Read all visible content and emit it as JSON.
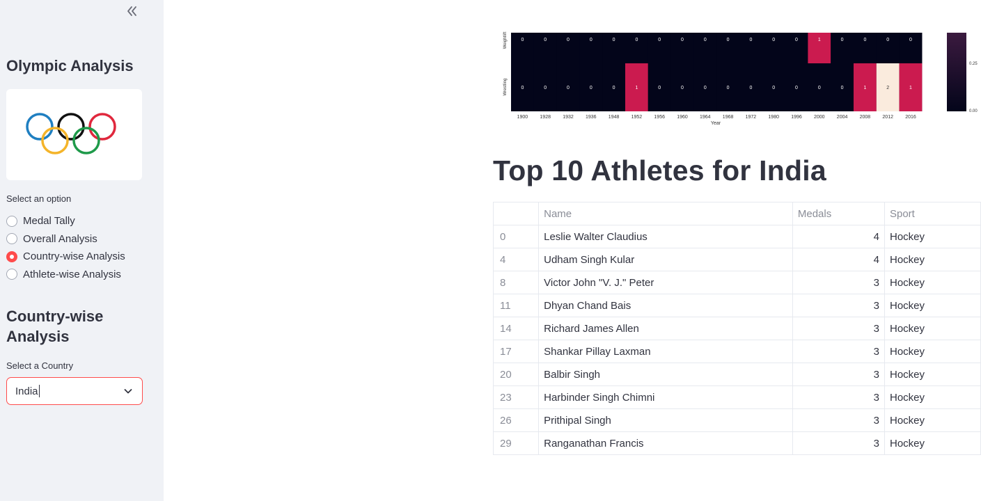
{
  "sidebar": {
    "collapse_icon": "double-chevron-left-icon",
    "title": "Olympic Analysis",
    "logo": "olympic-rings-logo",
    "option_label": "Select an option",
    "options": [
      {
        "label": "Medal Tally",
        "selected": false
      },
      {
        "label": "Overall Analysis",
        "selected": false
      },
      {
        "label": "Country-wise Analysis",
        "selected": true
      },
      {
        "label": "Athlete-wise Analysis",
        "selected": false
      }
    ],
    "subtitle": "Country-wise Analysis",
    "country_label": "Select a Country",
    "country_value": "India"
  },
  "chart_data": {
    "type": "heatmap",
    "x": [
      "1900",
      "1928",
      "1932",
      "1936",
      "1948",
      "1952",
      "1956",
      "1960",
      "1964",
      "1968",
      "1972",
      "1980",
      "1996",
      "2000",
      "2004",
      "2008",
      "2012",
      "2016"
    ],
    "y": [
      "Weightlift",
      "Wrestling"
    ],
    "values": [
      [
        0,
        0,
        0,
        0,
        0,
        0,
        0,
        0,
        0,
        0,
        0,
        0,
        0,
        1,
        0,
        0,
        0,
        0
      ],
      [
        0,
        0,
        0,
        0,
        0,
        1,
        0,
        0,
        0,
        0,
        0,
        0,
        0,
        0,
        0,
        1,
        2,
        1
      ]
    ],
    "xlabel": "Year",
    "colorbar_ticks": [
      "0.25",
      "0.00"
    ]
  },
  "main": {
    "heading": "Top 10 Athletes for India",
    "columns": [
      "",
      "Name",
      "Medals",
      "Sport"
    ],
    "rows": [
      {
        "idx": "0",
        "name": "Leslie Walter Claudius",
        "medals": "4",
        "sport": "Hockey"
      },
      {
        "idx": "4",
        "name": "Udham Singh Kular",
        "medals": "4",
        "sport": "Hockey"
      },
      {
        "idx": "8",
        "name": "Victor John \"V. J.\" Peter",
        "medals": "3",
        "sport": "Hockey"
      },
      {
        "idx": "11",
        "name": "Dhyan Chand Bais",
        "medals": "3",
        "sport": "Hockey"
      },
      {
        "idx": "14",
        "name": "Richard James Allen",
        "medals": "3",
        "sport": "Hockey"
      },
      {
        "idx": "17",
        "name": "Shankar Pillay Laxman",
        "medals": "3",
        "sport": "Hockey"
      },
      {
        "idx": "20",
        "name": "Balbir Singh",
        "medals": "3",
        "sport": "Hockey"
      },
      {
        "idx": "23",
        "name": "Harbinder Singh Chimni",
        "medals": "3",
        "sport": "Hockey"
      },
      {
        "idx": "26",
        "name": "Prithipal Singh",
        "medals": "3",
        "sport": "Hockey"
      },
      {
        "idx": "29",
        "name": "Ranganathan Francis",
        "medals": "3",
        "sport": "Hockey"
      }
    ]
  },
  "colors": {
    "accent": "#ff4b4b",
    "sidebar_bg": "#f0f2f6",
    "heat_zero": "#03051a",
    "heat_one": "#cb1b4f",
    "heat_two": "#faebdd"
  }
}
